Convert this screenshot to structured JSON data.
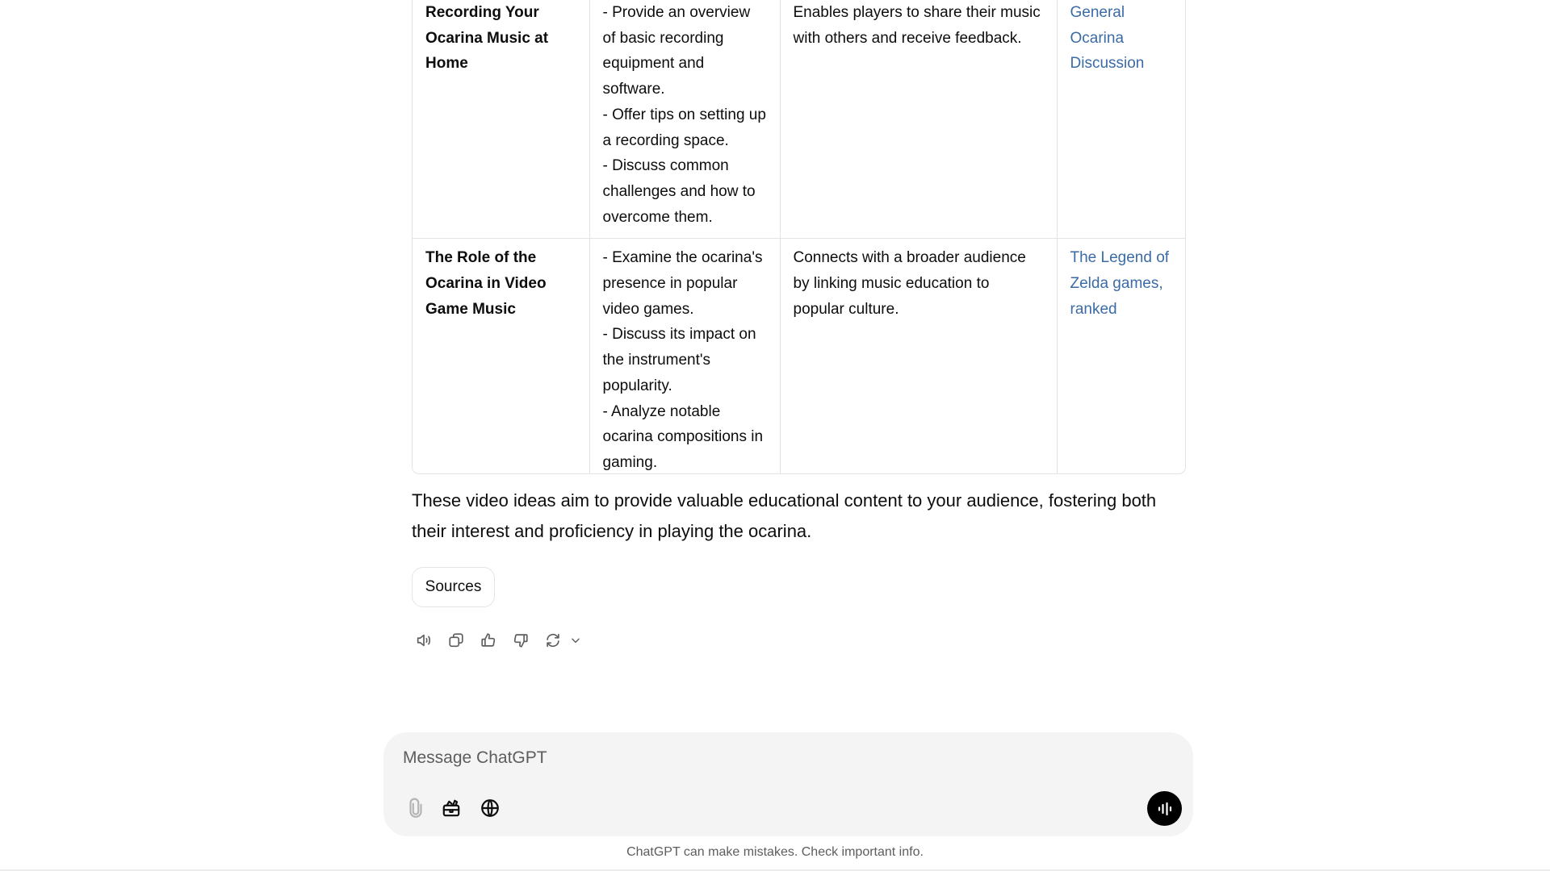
{
  "table": {
    "rows": [
      {
        "topic": "Recording Your Ocarina Music at Home",
        "details": [
          "- Provide an overview of basic recording equipment and software.",
          "- Offer tips on setting up a recording space.",
          "- Discuss common challenges and how to overcome them."
        ],
        "benefit": "Enables players to share their music with others and receive feedback.",
        "source_link": "General Ocarina Discussion"
      },
      {
        "topic": "The Role of the Ocarina in Video Game Music",
        "details": [
          "- Examine the ocarina's presence in popular video games.",
          "- Discuss its impact on the instrument's popularity.",
          "- Analyze notable ocarina compositions in gaming."
        ],
        "benefit": "Connects with a broader audience by linking music education to popular culture.",
        "source_link": "The Legend of Zelda games, ranked"
      }
    ]
  },
  "summary": "These video ideas aim to provide valuable educational content to your audience, fostering both their interest and proficiency in playing the ocarina.",
  "sources_button": "Sources",
  "message_actions": {
    "icons": [
      "speaker-icon",
      "copy-icon",
      "thumbs-up-icon",
      "thumbs-down-icon",
      "regenerate-icon",
      "chevron-down-icon"
    ]
  },
  "composer": {
    "placeholder": "Message ChatGPT",
    "value": "",
    "icons": [
      "paperclip-icon",
      "toolbox-icon",
      "globe-icon",
      "voice-waveform-icon"
    ]
  },
  "footer": "ChatGPT can make mistakes. Check important info.",
  "colors": {
    "link": "#3b6ba5",
    "composer_bg": "#f4f4f4",
    "border": "#e3e3e3",
    "voice_button": "#000000"
  }
}
